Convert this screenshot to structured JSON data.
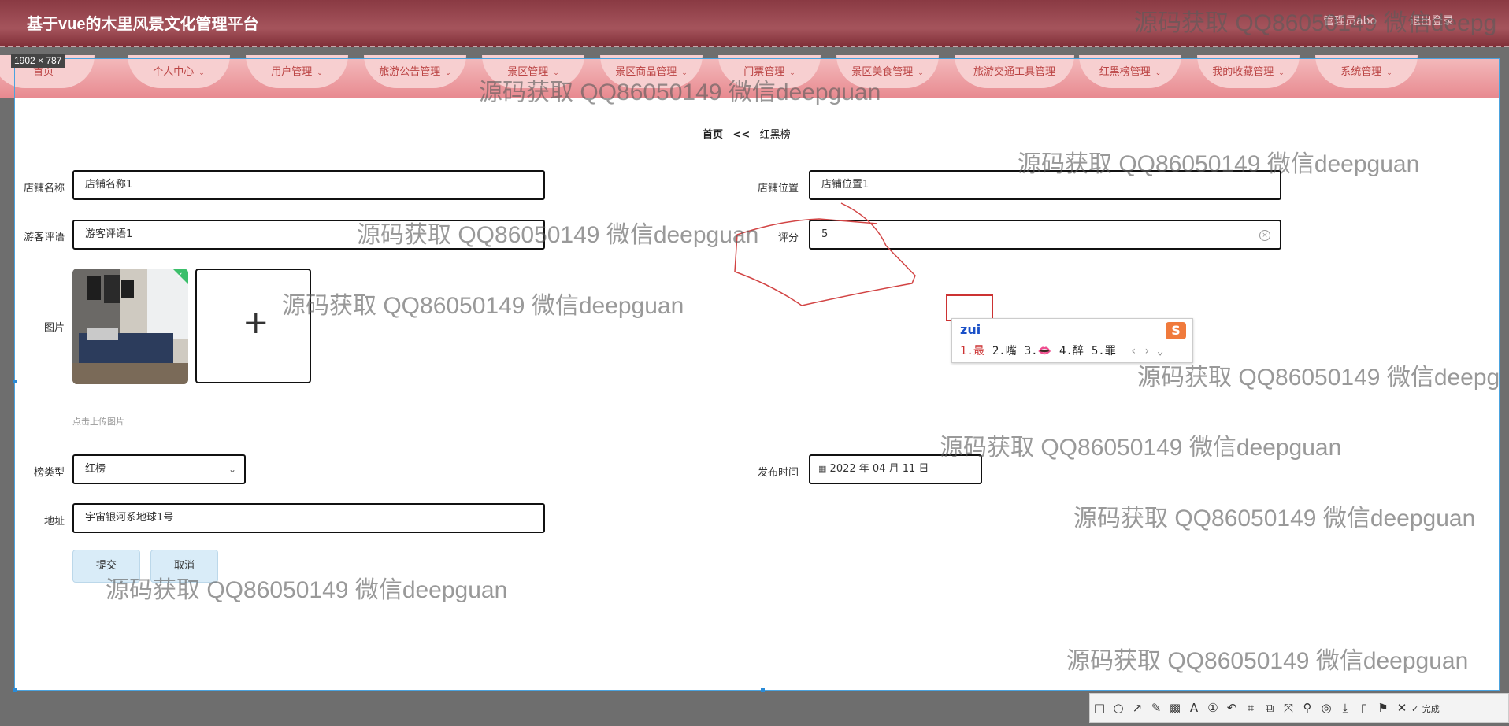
{
  "header": {
    "app_title": "基于vue的木里风景文化管理平台",
    "right_text_1": "管理员abo",
    "right_text_2": "退出登录"
  },
  "screenshot_tool": {
    "size_badge": "1902 × 787",
    "toolbar_done_label": "完成",
    "toolbar_icons": [
      "rectangle-icon",
      "ellipse-icon",
      "arrow-icon",
      "pen-icon",
      "mosaic-icon",
      "text-icon",
      "number-icon",
      "undo-icon",
      "crop-icon",
      "copy-icon",
      "pin-icon",
      "pin2-icon",
      "ocr-icon",
      "save-icon",
      "phone-icon",
      "bookmark-icon",
      "close-icon",
      "check-icon"
    ]
  },
  "nav": {
    "items": [
      {
        "label": "首页"
      },
      {
        "label": "个人中心"
      },
      {
        "label": "用户管理"
      },
      {
        "label": "旅游公告管理"
      },
      {
        "label": "景区管理"
      },
      {
        "label": "景区商品管理"
      },
      {
        "label": "门票管理"
      },
      {
        "label": "景区美食管理"
      },
      {
        "label": "旅游交通工具管理"
      },
      {
        "label": "红黑榜管理"
      },
      {
        "label": "我的收藏管理"
      },
      {
        "label": "系统管理"
      }
    ]
  },
  "breadcrumb": {
    "home": "首页",
    "separator": "<<",
    "current": "红黑榜"
  },
  "form": {
    "shop_name": {
      "label": "店铺名称",
      "value": "店铺名称1"
    },
    "shop_location": {
      "label": "店铺位置",
      "value": "店铺位置1"
    },
    "review": {
      "label": "游客评语",
      "value": "游客评语1"
    },
    "score": {
      "label": "评分",
      "value": "5"
    },
    "image": {
      "label": "图片",
      "upload_hint": "点击上传图片"
    },
    "list_type": {
      "label": "榜类型",
      "value": "红榜"
    },
    "publish_time": {
      "label": "发布时间",
      "value": "2022 年 04 月 11 日"
    },
    "address": {
      "label": "地址",
      "value": "宇宙银河系地球1号"
    },
    "submit_label": "提交",
    "cancel_label": "取消"
  },
  "ime": {
    "typed": "zui",
    "candidates": [
      "1.最",
      "2.嘴",
      "3.👄",
      "4.醉",
      "5.罪"
    ]
  },
  "watermark_text": "源码获取 QQ86050149 微信deepguan",
  "watermark_text_cut": "源码获取 QQ86050149 微信deepg"
}
